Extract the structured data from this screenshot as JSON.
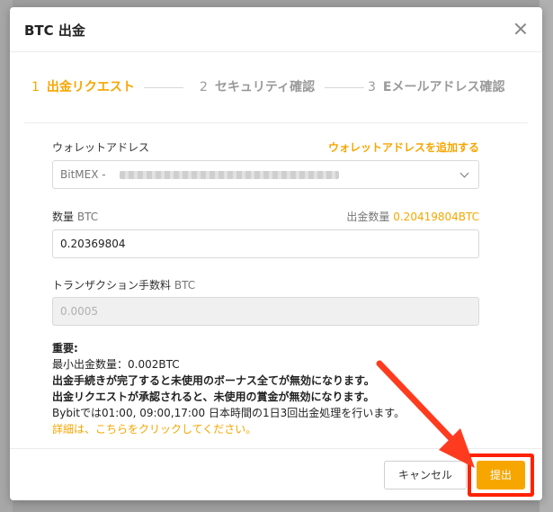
{
  "modal": {
    "title": "BTC 出金"
  },
  "steps": [
    {
      "num": "1",
      "label": "出金リクエスト"
    },
    {
      "num": "2",
      "label": "セキュリティ確認"
    },
    {
      "num": "3",
      "label": "Eメールアドレス確認"
    }
  ],
  "wallet": {
    "label": "ウォレットアドレス",
    "add_link": "ウォレットアドレスを追加する",
    "selected": "BitMEX -"
  },
  "amount": {
    "label": "数量",
    "unit": "BTC",
    "available_label": "出金数量",
    "available_value": "0.20419804BTC",
    "value": "0.20369804"
  },
  "fee": {
    "label": "トランザクション手数料",
    "unit": "BTC",
    "value": "0.0005"
  },
  "notes": {
    "heading": "重要:",
    "min": "最小出金数量：0.002BTC",
    "line1": "出金手続きが完了すると未使用のボーナス全てが無効になります。",
    "line2": "出金リクエストが承認されると、未使用の賞金が無効になります。",
    "line3": "Bybitでは01:00, 09:00,17:00 日本時間の1日3回出金処理を行います。",
    "detail_link": "詳細は、こちらをクリックしてください。"
  },
  "buttons": {
    "cancel": "キャンセル",
    "submit": "提出"
  },
  "colors": {
    "accent": "#f7a600",
    "highlight": "#ff2200"
  }
}
